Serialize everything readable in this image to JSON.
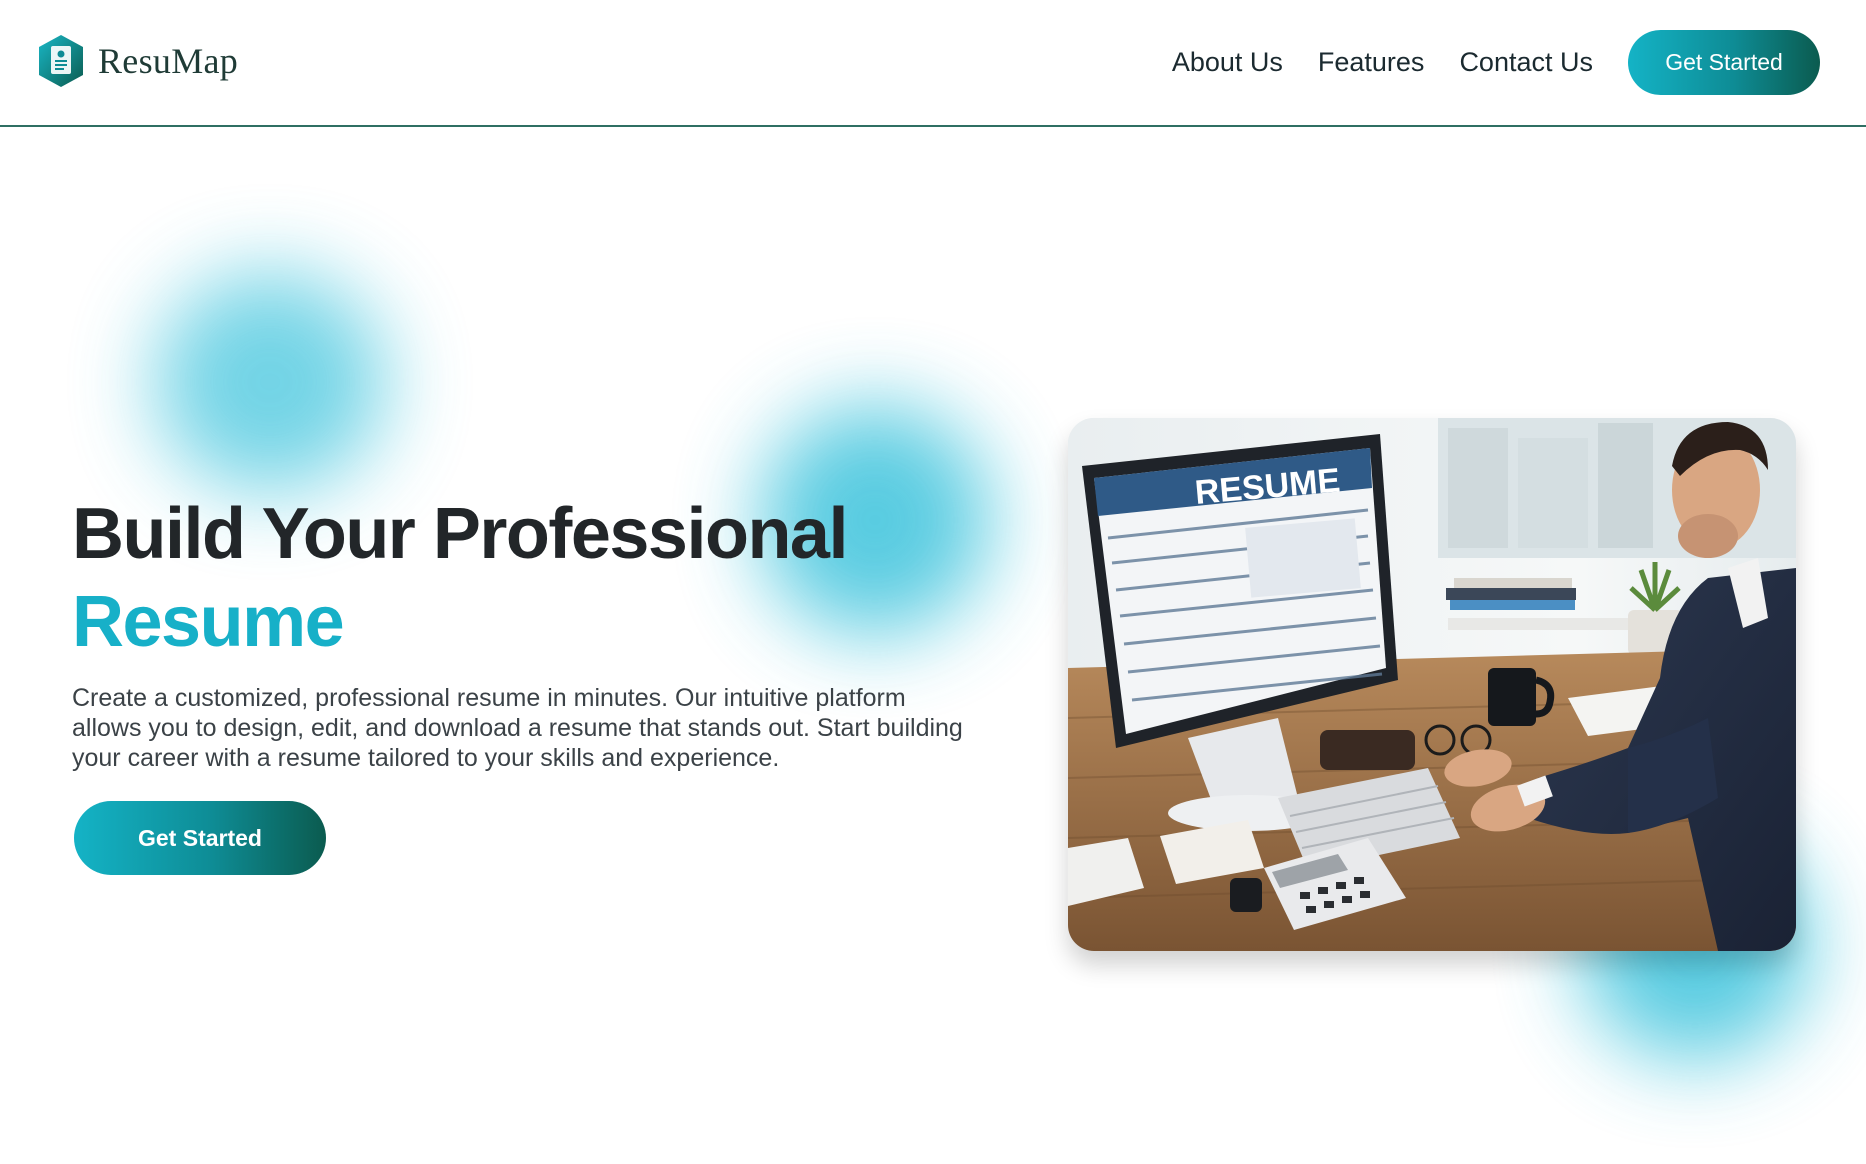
{
  "brand": {
    "name": "ResuMap",
    "accent_color": "#17b0c8",
    "dark_color": "#0b5b4f"
  },
  "header": {
    "nav": [
      {
        "label": "About Us"
      },
      {
        "label": "Features"
      },
      {
        "label": "Contact Us"
      }
    ],
    "cta_label": "Get Started"
  },
  "hero": {
    "title_line1": "Build Your Professional",
    "title_line2": "Resume",
    "description": "Create a customized, professional resume in minutes. Our intuitive platform allows you to design, edit, and download a resume that stands out. Start building your career with a resume tailored to your skills and experience.",
    "cta_label": "Get Started",
    "image": {
      "monitor_text": "RESUME",
      "subject": "man-at-desk-editing-resume"
    }
  }
}
